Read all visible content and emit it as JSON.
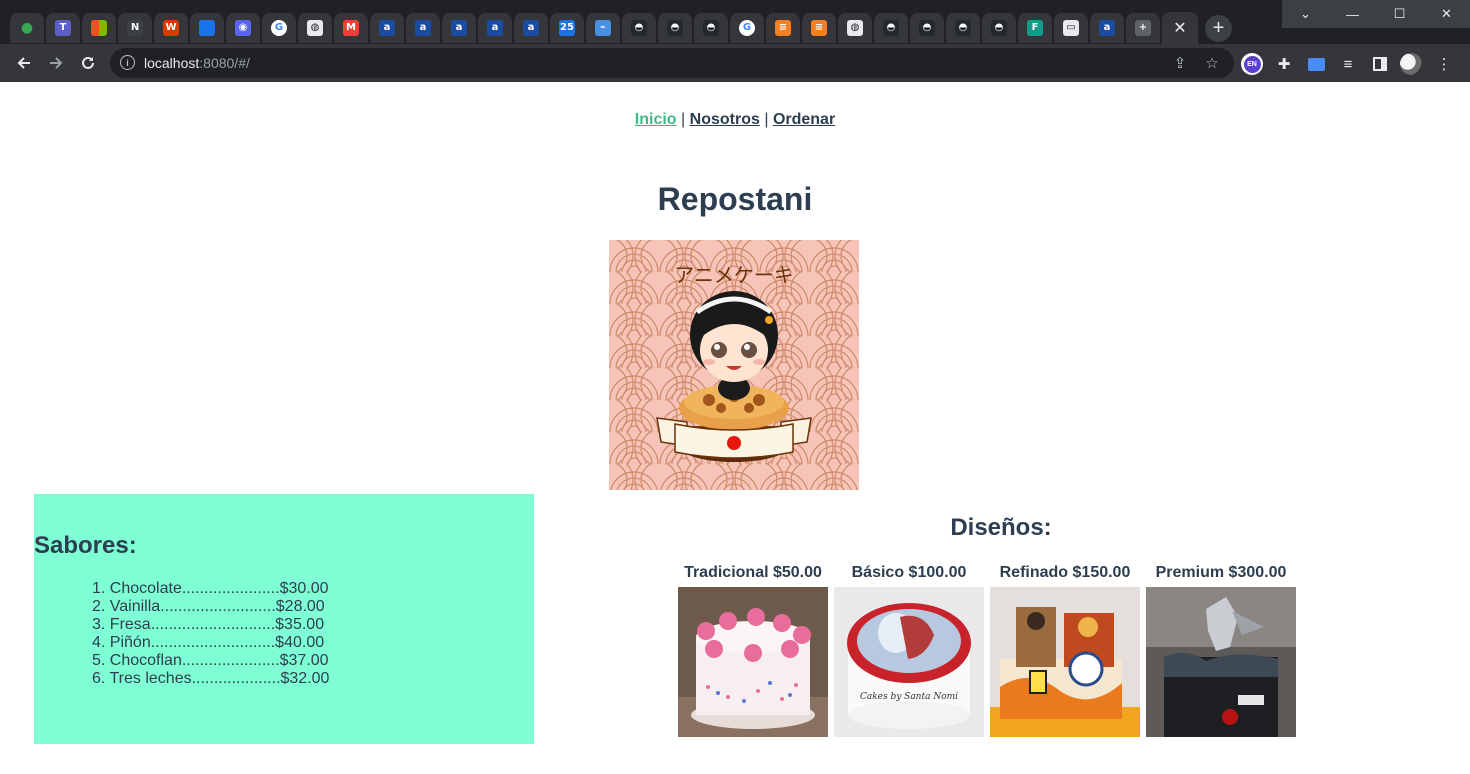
{
  "browser": {
    "url_host": "localhost",
    "url_rest": ":8080/#/",
    "profile_badge": "EN",
    "colors": {
      "tabbar": "#202124",
      "toolbar": "#35363a",
      "omnibox": "#202124"
    },
    "tab_icons": [
      "green-dot-icon",
      "teams-icon",
      "microsoft-icon",
      "notion-icon",
      "office-icon",
      "tab-icon",
      "discord-icon",
      "google-icon",
      "globe-icon",
      "gmail-icon",
      "app-icon",
      "app-icon",
      "app-icon",
      "app-icon",
      "app-icon",
      "calendar-icon",
      "wifi-icon",
      "github-icon",
      "github-icon",
      "github-icon",
      "google-icon",
      "stackoverflow-icon",
      "stackoverflow-icon",
      "globe-icon",
      "github-icon",
      "github-icon",
      "github-icon",
      "github-icon",
      "figma-icon",
      "window-icon",
      "app-icon",
      "new-tab-icon"
    ]
  },
  "nav": {
    "inicio": "Inicio",
    "separator": "|",
    "nosotros": "Nosotros",
    "ordenar": "Ordenar",
    "active_color": "#42b983"
  },
  "header": {
    "title": "Repostani"
  },
  "logo": {
    "text": "アニメケーキ"
  },
  "sabores": {
    "title": "Sabores:",
    "background": "#7fffd4",
    "items": [
      {
        "label": "1. Chocolate......................$30.00"
      },
      {
        "label": "2. Vainilla..........................$28.00"
      },
      {
        "label": "3. Fresa............................$35.00"
      },
      {
        "label": "4. Piñón............................$40.00"
      },
      {
        "label": "5. Chocoflan......................$37.00"
      },
      {
        "label": "6. Tres leches....................$32.00"
      }
    ]
  },
  "disenos": {
    "title": "Diseños:",
    "items": [
      {
        "label": "Tradicional $50.00"
      },
      {
        "label": "Básico $100.00"
      },
      {
        "label": "Refinado $150.00"
      },
      {
        "label": "Premium $300.00"
      }
    ]
  }
}
